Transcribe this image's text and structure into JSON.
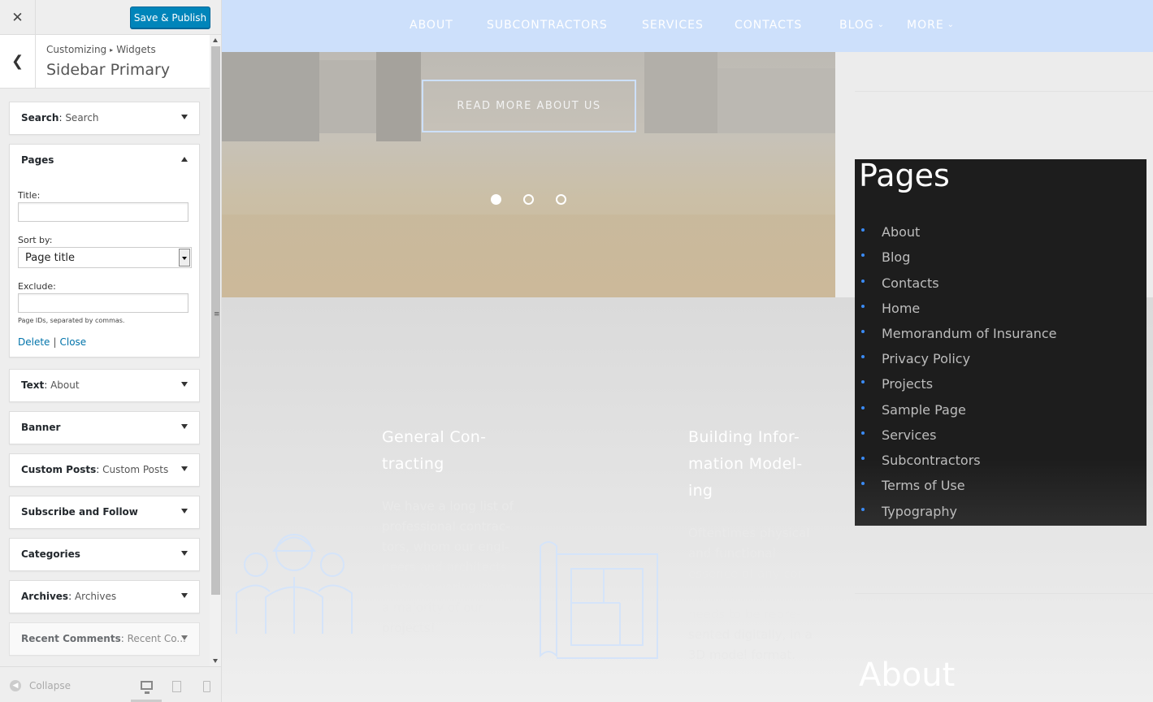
{
  "customizer": {
    "close_icon": "close-icon",
    "publish_label": "Save & Publish",
    "breadcrumb": [
      "Customizing",
      "Widgets"
    ],
    "section_title": "Sidebar Primary",
    "widgets": [
      {
        "name": "Search",
        "sub": "Search",
        "expanded": false
      },
      {
        "name": "Pages",
        "sub": "",
        "expanded": true
      },
      {
        "name": "Text",
        "sub": "About",
        "expanded": false
      },
      {
        "name": "Banner",
        "sub": "",
        "expanded": false
      },
      {
        "name": "Custom Posts",
        "sub": "Custom Posts",
        "expanded": false
      },
      {
        "name": "Subscribe and Follow",
        "sub": "",
        "expanded": false
      },
      {
        "name": "Categories",
        "sub": "",
        "expanded": false
      },
      {
        "name": "Archives",
        "sub": "Archives",
        "expanded": false
      },
      {
        "name": "Recent Comments",
        "sub": "Recent Co...",
        "expanded": false
      }
    ],
    "pages_form": {
      "title_label": "Title:",
      "title_value": "",
      "sort_label": "Sort by:",
      "sort_value": "Page title",
      "exclude_label": "Exclude:",
      "exclude_value": "",
      "help_text": "Page IDs, separated by commas.",
      "delete_label": "Delete",
      "separator": "|",
      "close_label": "Close"
    },
    "footer": {
      "collapse_label": "Collapse",
      "devices": [
        "desktop",
        "tablet",
        "mobile"
      ],
      "active_device": "desktop"
    }
  },
  "preview": {
    "nav": [
      "ABOUT",
      "SUBCONTRACTORS",
      "SERVICES",
      "CONTACTS",
      "BLOG",
      "MORE"
    ],
    "read_more_label": "READ MORE ABOUT US",
    "slider_dots": 3,
    "active_dot": 0,
    "features": [
      {
        "title_lines": [
          "General Con-",
          "tracting"
        ],
        "text_lines": [
          "We have a long list of",
          "professional contrac-",
          "tors, whom our engi-",
          "neers and architects",
          "enjoy to work with on",
          "a majority of our",
          "projects!"
        ]
      },
      {
        "title_lines": [
          "Building Infor-",
          "mation Model-",
          "ing"
        ],
        "text_lines": [
          "Oftentimes physical",
          "and functional",
          "essence of any con-",
          "struction project",
          "needs to be repre-",
          "sented digitally, in a",
          "3D model format."
        ]
      }
    ],
    "pages_widget": {
      "title": "Pages",
      "items": [
        "About",
        "Blog",
        "Contacts",
        "Home",
        "Memorandum of Insurance",
        "Privacy Policy",
        "Projects",
        "Sample Page",
        "Services",
        "Subcontractors",
        "Terms of Use",
        "Typography"
      ]
    },
    "about_heading": "About",
    "colors": {
      "accent": "#0085ba",
      "nav_bg": "#cde0fb",
      "widget_bg": "#1d1d1d",
      "bullet": "#3b8bf5"
    }
  }
}
